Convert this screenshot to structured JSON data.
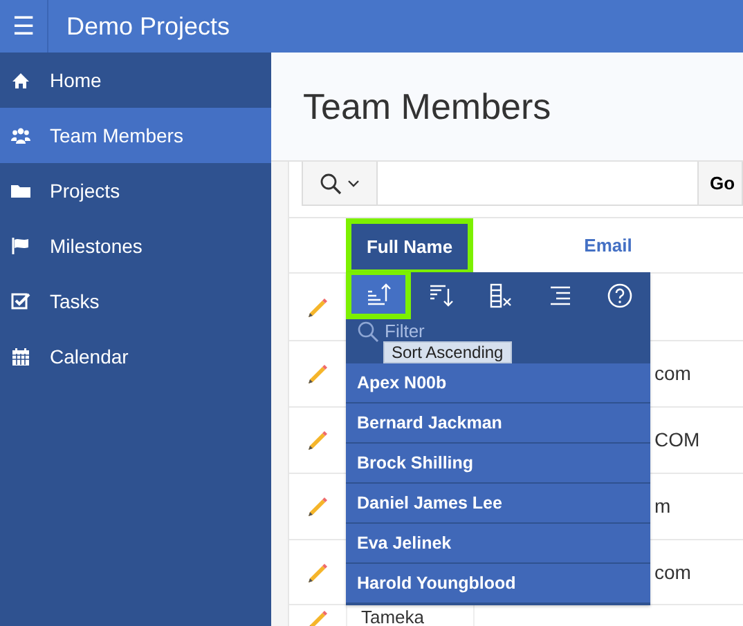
{
  "header": {
    "menu_icon": "☰",
    "title": "Demo Projects"
  },
  "sidebar": {
    "items": [
      {
        "label": "Home",
        "selected": false
      },
      {
        "label": "Team Members",
        "selected": true
      },
      {
        "label": "Projects",
        "selected": false
      },
      {
        "label": "Milestones",
        "selected": false
      },
      {
        "label": "Tasks",
        "selected": false
      },
      {
        "label": "Calendar",
        "selected": false
      }
    ]
  },
  "page_title": "Team Members",
  "toolbar": {
    "go_button": "Go"
  },
  "table": {
    "columns": [
      {
        "label": "Full Name",
        "selected": true
      },
      {
        "label": "Email",
        "selected": false
      }
    ],
    "rows": [
      {},
      {
        "email": "com"
      },
      {
        "email": "COM"
      },
      {
        "email": "m"
      },
      {
        "email": "com"
      },
      {
        "full_name": "Tameka"
      }
    ]
  },
  "column_menu": {
    "actions": [
      {
        "kind": "sort-ascending",
        "selected": true
      },
      {
        "kind": "sort-descending",
        "selected": false
      },
      {
        "kind": "hide-column",
        "selected": false
      },
      {
        "kind": "control-break",
        "selected": false
      },
      {
        "kind": "help",
        "selected": false
      }
    ],
    "tooltip": "Sort Ascending",
    "filter": {
      "placeholder": "Filter"
    },
    "values": [
      "Apex N00b",
      "Bernard Jackman",
      "Brock Shilling",
      "Daniel James Lee",
      "Eva Jelinek",
      "Harold Youngblood"
    ]
  }
}
